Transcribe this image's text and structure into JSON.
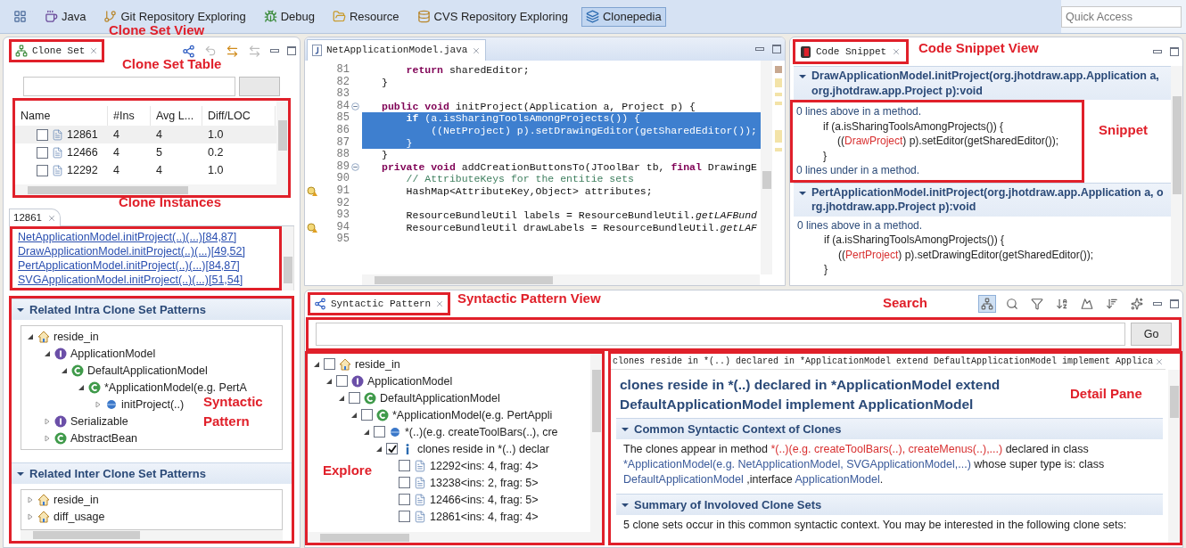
{
  "perspective_bar": {
    "items": [
      {
        "kind": "open",
        "selected": false
      },
      {
        "kind": "java",
        "label": "Java",
        "selected": false
      },
      {
        "kind": "git",
        "label": "Git Repository Exploring",
        "selected": false
      },
      {
        "kind": "debug",
        "label": "Debug",
        "selected": false
      },
      {
        "kind": "resource",
        "label": "Resource",
        "selected": false
      },
      {
        "kind": "cvs",
        "label": "CVS Repository Exploring",
        "selected": false
      },
      {
        "kind": "clonepedia",
        "label": "Clonepedia",
        "selected": true
      }
    ],
    "quick_access": {
      "placeholder": "Quick Access"
    }
  },
  "clone_set_view": {
    "tab": "Clone Set",
    "annotation": "Clone Set View",
    "table_annotation": "Clone Set Table",
    "table": {
      "columns": [
        "Name",
        "#Ins",
        "Avg L...",
        "Diff/LOC"
      ],
      "rows": [
        {
          "cells": [
            "12861",
            "4",
            "4",
            "1.0"
          ],
          "checked": false,
          "selected": true
        },
        {
          "cells": [
            "12466",
            "4",
            "5",
            "0.2"
          ],
          "checked": false,
          "selected": false
        },
        {
          "cells": [
            "12292",
            "4",
            "4",
            "1.0"
          ],
          "checked": false,
          "selected": false
        }
      ]
    },
    "instances": {
      "tab": "12861",
      "annotation": "Clone Instances",
      "links": [
        "NetApplicationModel.initProject(..)(...)[84,87]",
        "DrawApplicationModel.initProject(..)(...)[49,52]",
        "PertApplicationModel.initProject(..)(...)[84,87]",
        "SVGApplicationModel.initProject(..)(...)[51,54]"
      ]
    },
    "pattern_annotation": "Syntactic Pattern",
    "intra": {
      "title": "Related Intra Clone Set Patterns",
      "expanded": true,
      "tree": [
        {
          "label": "reside_in",
          "kind": "pattern",
          "expanded": true,
          "children": [
            {
              "label": "ApplicationModel",
              "kind": "interface",
              "expanded": true,
              "children": [
                {
                  "label": "DefaultApplicationModel",
                  "kind": "class",
                  "expanded": true,
                  "children": [
                    {
                      "label": "*ApplicationModel(e.g. PertA",
                      "kind": "class",
                      "expanded": true,
                      "children": [
                        {
                          "label": "initProject(..)",
                          "kind": "method",
                          "expanded": false
                        }
                      ]
                    }
                  ]
                }
              ]
            },
            {
              "label": "Serializable",
              "kind": "interface",
              "expanded": false
            },
            {
              "label": "AbstractBean",
              "kind": "class",
              "expanded": false
            }
          ]
        }
      ]
    },
    "inter": {
      "title": "Related Inter Clone Set Patterns",
      "expanded": true,
      "tree": [
        {
          "label": "reside_in",
          "kind": "pattern",
          "expanded": false
        },
        {
          "label": "diff_usage",
          "kind": "pattern",
          "expanded": false
        }
      ]
    }
  },
  "editor": {
    "tab": "NetApplicationModel.java",
    "lines": [
      {
        "number": "81",
        "code": "    **return** sharedEditor;",
        "selected": false,
        "foldable": false,
        "warning": false
      },
      {
        "number": "82",
        "code": "}",
        "selected": false,
        "foldable": false,
        "warning": false
      },
      {
        "number": "83",
        "selected": false,
        "foldable": false,
        "warning": false
      },
      {
        "number": "84",
        "code": "**public** **void** initProject(Application a, Project p) {",
        "selected": false,
        "foldable": true,
        "warning": false
      },
      {
        "number": "85",
        "code": "    **if** (a.isSharingToolsAmongProjects()) {",
        "selected": true,
        "foldable": false,
        "warning": false
      },
      {
        "number": "86",
        "code": "        ((NetProject) p).setDrawingEditor(getSharedEditor());",
        "selected": true,
        "foldable": false,
        "warning": false
      },
      {
        "number": "87",
        "code": "    }",
        "selected": true,
        "foldable": false,
        "warning": false
      },
      {
        "number": "88",
        "code": "}",
        "selected": false,
        "foldable": false,
        "warning": false
      },
      {
        "number": "89",
        "code": "**private** **void** addCreationButtonsTo(JToolBar tb, **final** DrawingE",
        "selected": false,
        "foldable": true,
        "warning": false
      },
      {
        "number": "90",
        "code": "    // AttributeKeys for the entitie sets",
        "selected": false,
        "kind": "comment",
        "foldable": false,
        "warning": false
      },
      {
        "number": "91",
        "code": "    HashMap<AttributeKey,Object> attributes;",
        "selected": false,
        "foldable": false,
        "warning": true
      },
      {
        "number": "92",
        "selected": false,
        "foldable": false,
        "warning": false
      },
      {
        "number": "93",
        "code": "    ResourceBundleUtil labels = ResourceBundleUtil.*getLAFBund*",
        "selected": false,
        "foldable": false,
        "warning": false
      },
      {
        "number": "94",
        "code": "    ResourceBundleUtil drawLabels = ResourceBundleUtil.*getLAF*",
        "selected": false,
        "foldable": false,
        "warning": true
      },
      {
        "number": "95",
        "selected": false,
        "foldable": false,
        "warning": false
      }
    ]
  },
  "code_snippet_view": {
    "tab": "Code Snippet",
    "annotation": "Code Snippet View",
    "snippet_annotation": "Snippet",
    "sections": [
      {
        "title": "DrawApplicationModel.initProject(org.jhotdraw.app.Application a, org.jhotdraw.app.Project p):void",
        "expanded": true,
        "highlighted": true,
        "above": "0 lines above in a method.",
        "code": [
          [
            {
              "text": "if (a.isSharingToolsAmongProjects()) {",
              "kind": "plain"
            }
          ],
          [
            {
              "text": "((",
              "kind": "plain"
            },
            {
              "text": "DrawProject",
              "kind": "diff"
            },
            {
              "text": ") p).setEditor(getSharedEditor());",
              "kind": "plain"
            }
          ],
          [
            {
              "text": "}",
              "kind": "plain"
            }
          ]
        ],
        "under": "0 lines under in a method."
      },
      {
        "title": "PertApplicationModel.initProject(org.jhotdraw.app.Application a, org.jhotdraw.app.Project p):void",
        "expanded": true,
        "highlighted": false,
        "above": "0 lines above in a method.",
        "code": [
          [
            {
              "text": "if (a.isSharingToolsAmongProjects()) {",
              "kind": "plain"
            }
          ],
          [
            {
              "text": "((",
              "kind": "plain"
            },
            {
              "text": "PertProject",
              "kind": "diff"
            },
            {
              "text": ") p).setDrawingEditor(getSharedEditor());",
              "kind": "plain"
            }
          ],
          [
            {
              "text": "}",
              "kind": "plain"
            }
          ]
        ]
      }
    ]
  },
  "syntactic_pattern_view": {
    "tab": "Syntactic Pattern",
    "annotation": "Syntactic Pattern View",
    "search_annotation": "Search",
    "toolbar": [
      {
        "kind": "hierarchy",
        "on": true
      },
      {
        "kind": "find",
        "on": false
      },
      {
        "kind": "filter",
        "on": false
      },
      {
        "kind": "sort",
        "on": false
      },
      {
        "kind": "chart",
        "on": false
      },
      {
        "kind": "sort_desc",
        "on": false
      },
      {
        "kind": "sparkle",
        "on": false
      }
    ],
    "search": {
      "button": "Go"
    },
    "explore": {
      "annotation": "Explore",
      "tree": [
        {
          "label": "reside_in",
          "kind": "pattern",
          "expanded": true,
          "checked": false,
          "children": [
            {
              "label": "ApplicationModel",
              "kind": "interface",
              "expanded": true,
              "checked": false,
              "children": [
                {
                  "label": "DefaultApplicationModel",
                  "kind": "class",
                  "expanded": true,
                  "checked": false,
                  "children": [
                    {
                      "label": "*ApplicationModel(e.g. PertAppli",
                      "kind": "class",
                      "expanded": true,
                      "checked": false,
                      "children": [
                        {
                          "label": "*(..)(e.g. createToolBars(..), cre",
                          "kind": "method",
                          "expanded": true,
                          "checked": false,
                          "children": [
                            {
                              "label": "clones reside in *(..) declar",
                              "kind": "info",
                              "expanded": true,
                              "checked": true,
                              "children": [
                                {
                                  "label": "12292<ins: 4, frag: 4>",
                                  "kind": "clone_set",
                                  "checked": false
                                },
                                {
                                  "label": "13238<ins: 2, frag: 5>",
                                  "kind": "clone_set",
                                  "checked": false
                                },
                                {
                                  "label": "12466<ins: 4, frag: 5>",
                                  "kind": "clone_set",
                                  "checked": false
                                },
                                {
                                  "label": "12861<ins: 4, frag: 4>",
                                  "kind": "clone_set",
                                  "checked": false
                                }
                              ]
                            }
                          ]
                        }
                      ]
                    }
                  ]
                }
              ]
            }
          ]
        }
      ]
    },
    "detail": {
      "annotation": "Detail Pane",
      "tab": "clones reside in *(..) declared in *ApplicationModel extend DefaultApplicationModel implement Applica",
      "heading": "clones reside in *(..) declared in *ApplicationModel extend DefaultApplicationModel implement ApplicationModel",
      "sections": [
        {
          "title": "Common Syntactic Context of Clones",
          "expanded": true,
          "text": [
            {
              "text": "The clones appear in method ",
              "kind": "plain"
            },
            {
              "text": "*(..)(e.g. createToolBars(..), createMenus(..),...)",
              "kind": "method"
            },
            {
              "text": " declared in class ",
              "kind": "plain"
            },
            {
              "text": "*ApplicationModel(e.g. NetApplicationModel, SVGApplicationModel,...)",
              "kind": "type"
            },
            {
              "text": " whose super type is: class ",
              "kind": "plain"
            },
            {
              "text": "DefaultApplicationModel",
              "kind": "type"
            },
            {
              "text": " ,interface ",
              "kind": "plain"
            },
            {
              "text": "ApplicationModel",
              "kind": "type"
            },
            {
              "text": ".",
              "kind": "plain"
            }
          ]
        },
        {
          "title": "Summary of Involoved Clone Sets",
          "expanded": true,
          "text": [
            {
              "text": "5 clone sets occur in this common syntactic context. You may be interested in the following clone sets:",
              "kind": "plain"
            }
          ]
        }
      ]
    }
  }
}
